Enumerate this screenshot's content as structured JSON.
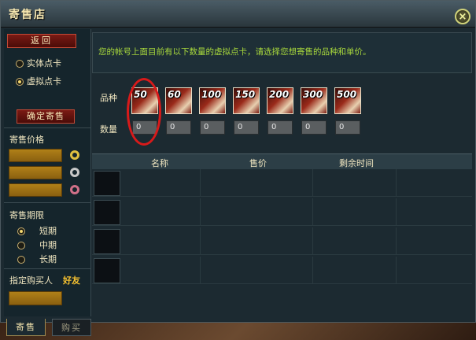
{
  "window": {
    "title": "寄售店",
    "close_label": "×"
  },
  "left": {
    "back_label": "返回",
    "card_types": [
      {
        "label": "实体点卡",
        "selected": false
      },
      {
        "label": "虚拟点卡",
        "selected": true
      }
    ],
    "confirm_label": "确定寄售",
    "price_label": "寄售价格",
    "duration_label": "寄售期限",
    "durations": [
      {
        "label": "短期",
        "selected": true
      },
      {
        "label": "中期",
        "selected": false
      },
      {
        "label": "长期",
        "selected": false
      }
    ],
    "buyer_label": "指定购买人",
    "friend_label": "好友"
  },
  "tabs": [
    {
      "label": "寄售",
      "active": true
    },
    {
      "label": "购买",
      "active": false
    }
  ],
  "main": {
    "info_text": "您的帐号上面目前有以下数量的虚拟点卡，请选择您想寄售的品种和单价。",
    "variety_label": "品种",
    "quantity_label": "数量",
    "cards": [
      {
        "value": "50",
        "qty": "0"
      },
      {
        "value": "60",
        "qty": "0"
      },
      {
        "value": "100",
        "qty": "0"
      },
      {
        "value": "150",
        "qty": "0"
      },
      {
        "value": "200",
        "qty": "0"
      },
      {
        "value": "300",
        "qty": "0"
      },
      {
        "value": "500",
        "qty": "0"
      }
    ],
    "table": {
      "headers": [
        "名称",
        "售价",
        "剩余时间"
      ],
      "rows": 4
    }
  },
  "colors": {
    "accent_gold": "#f4c030",
    "info_green": "#a8d83c",
    "highlight_red": "#d81a1a"
  }
}
